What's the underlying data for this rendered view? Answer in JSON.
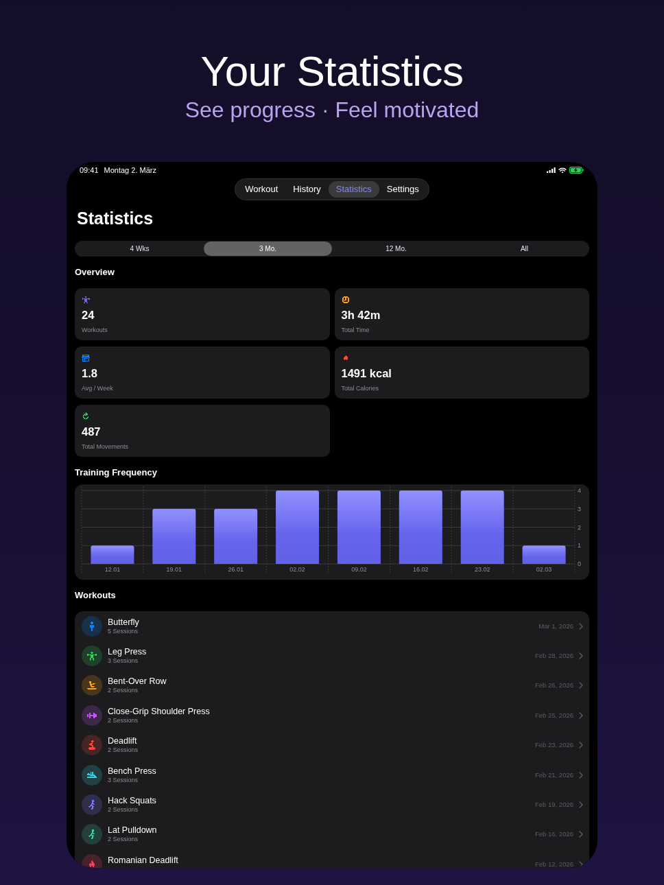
{
  "hero": {
    "title": "Your Statistics",
    "subtitle": "See progress · Feel motivated"
  },
  "status_bar": {
    "time": "09:41",
    "date": "Montag 2. März"
  },
  "tabs": [
    {
      "label": "Workout",
      "selected": false
    },
    {
      "label": "History",
      "selected": false
    },
    {
      "label": "Statistics",
      "selected": true
    },
    {
      "label": "Settings",
      "selected": false
    }
  ],
  "title": "Statistics",
  "periods": [
    {
      "label": "4 Wks",
      "selected": false
    },
    {
      "label": "3 Mo.",
      "selected": true
    },
    {
      "label": "12 Mo.",
      "selected": false
    },
    {
      "label": "All",
      "selected": false
    }
  ],
  "overview": {
    "heading": "Overview",
    "stats": [
      {
        "value": "24",
        "label": "Workouts",
        "color": "#6e68f0"
      },
      {
        "value": "3h 42m",
        "label": "Total Time",
        "color": "#ff9f0a"
      },
      {
        "value": "1.8",
        "label": "Avg / Week",
        "color": "#0a84ff"
      },
      {
        "value": "1491 kcal",
        "label": "Total Calories",
        "color": "#ff453a"
      },
      {
        "value": "487",
        "label": "Total Movements",
        "color": "#30d158"
      }
    ]
  },
  "training_frequency": {
    "heading": "Training Frequency",
    "chart_data": {
      "type": "bar",
      "categories": [
        "12.01",
        "19.01",
        "26.01",
        "02.02",
        "09.02",
        "16.02",
        "23.02",
        "02.03"
      ],
      "values": [
        1,
        3,
        3,
        4,
        4,
        4,
        4,
        1
      ],
      "ylim": [
        0,
        4
      ],
      "yticks": [
        0,
        1,
        2,
        3,
        4
      ],
      "grid": true
    }
  },
  "workouts": {
    "heading": "Workouts",
    "items": [
      {
        "name": "Butterfly",
        "sessions": "5 Sessions",
        "date": "Mar 1, 2026",
        "color": "#0a84ff"
      },
      {
        "name": "Leg Press",
        "sessions": "3 Sessions",
        "date": "Feb 28, 2026",
        "color": "#30d158"
      },
      {
        "name": "Bent-Over Row",
        "sessions": "2 Sessions",
        "date": "Feb 26, 2026",
        "color": "#ff9f0a"
      },
      {
        "name": "Close-Grip Shoulder Press",
        "sessions": "2 Sessions",
        "date": "Feb 25, 2026",
        "color": "#bf5af2"
      },
      {
        "name": "Deadlift",
        "sessions": "2 Sessions",
        "date": "Feb 23, 2026",
        "color": "#ff453a"
      },
      {
        "name": "Bench Press",
        "sessions": "3 Sessions",
        "date": "Feb 21, 2026",
        "color": "#32d4e6"
      },
      {
        "name": "Hack Squats",
        "sessions": "2 Sessions",
        "date": "Feb 19, 2026",
        "color": "#7d7aff"
      },
      {
        "name": "Lat Pulldown",
        "sessions": "2 Sessions",
        "date": "Feb 16, 2026",
        "color": "#34d3a8"
      },
      {
        "name": "Romanian Deadlift",
        "date": "Feb 12, 2026",
        "color": "#ff375f"
      }
    ]
  }
}
